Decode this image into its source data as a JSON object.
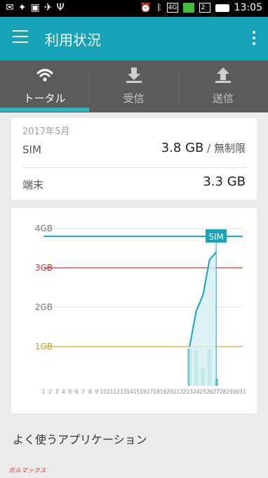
{
  "status_bar": {
    "time": "13:05",
    "network_label": "4G",
    "sim2_label": "2"
  },
  "app_bar": {
    "title": "利用状況"
  },
  "tabs": [
    {
      "label": "トータル",
      "selected": true,
      "icon": "wifi-icon"
    },
    {
      "label": "受信",
      "selected": false,
      "icon": "download-icon"
    },
    {
      "label": "送信",
      "selected": false,
      "icon": "upload-icon"
    }
  ],
  "summary": {
    "month": "2017年5月",
    "sim_label": "SIM",
    "sim_value": "3.8 GB",
    "sim_limit": " / 無制限",
    "device_label": "端末",
    "device_value": "3.3 GB"
  },
  "chart_data": {
    "type": "area",
    "y_ticks": [
      "4GB",
      "3GB",
      "2GB",
      "1GB"
    ],
    "x_ticks": [
      "1",
      "2",
      "3",
      "4",
      "5",
      "6",
      "7",
      "8",
      "9",
      "10",
      "11",
      "12",
      "13",
      "14",
      "15",
      "16",
      "17",
      "18",
      "19",
      "20",
      "21",
      "22",
      "23",
      "24",
      "25",
      "26",
      "27",
      "28",
      "29",
      "30",
      "31"
    ],
    "ylim": [
      0,
      4.5
    ],
    "cumulative_days": [
      23,
      24,
      25,
      26,
      27
    ],
    "cumulative_values": [
      1.0,
      1.9,
      2.3,
      3.2,
      3.4
    ],
    "daily_days": [
      23,
      24,
      25,
      26,
      27
    ],
    "daily_values": [
      0.95,
      0.92,
      0.45,
      0.95,
      0.18
    ],
    "sim_line_value": 3.8,
    "sim_line_label": "SIM",
    "reference_lines": [
      {
        "value": 3,
        "color": "#c0392b"
      },
      {
        "value": 1,
        "color": "#e0a830"
      }
    ],
    "colors": {
      "accent": "#17a2b8",
      "area": "#d4f0f3",
      "bars": "#7fcbd6"
    }
  },
  "apps_section": {
    "title": "よく使うアプリケーション"
  },
  "watermark": "ガルマックス"
}
